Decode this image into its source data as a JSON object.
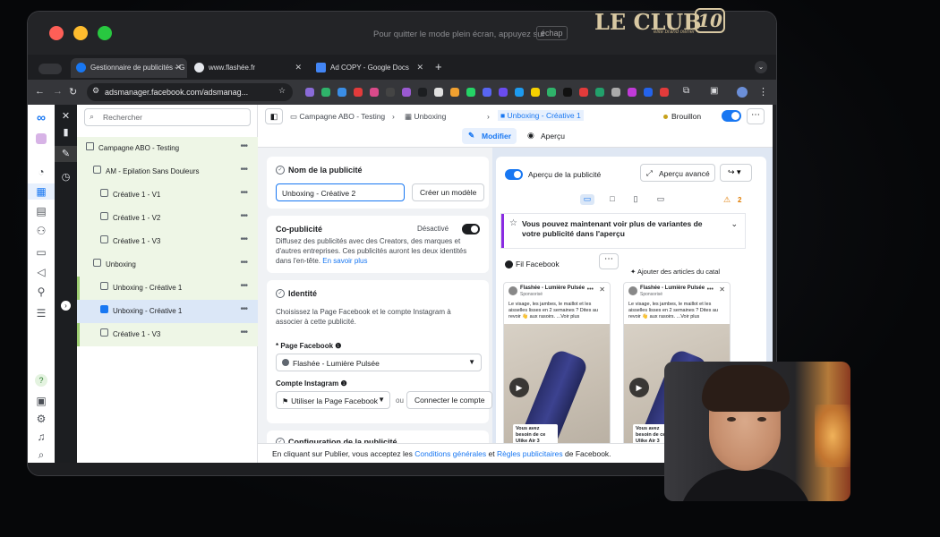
{
  "screen": {
    "fullscreen_message": "Pour quitter le mode plein écran, appuyez sur",
    "fullscreen_key": "échap",
    "brand_logo_text": "LE CLUB",
    "brand_logo_number": "10",
    "brand_logo_subtitle": "elite brand owner"
  },
  "browser": {
    "tabs": [
      {
        "label": "Gestionnaire de publicités - G",
        "icon": "meta-icon",
        "active": true
      },
      {
        "label": "www.flashée.fr",
        "icon": "globe-icon",
        "active": false
      },
      {
        "label": "Ad COPY - Google Docs",
        "icon": "docs-icon",
        "active": false
      }
    ],
    "url": "adsmanager.facebook.com/adsmanag..."
  },
  "tree": {
    "search_placeholder": "Rechercher",
    "rows": [
      {
        "label": "Campagne ABO - Testing",
        "level": 0,
        "icon": "folder-icon"
      },
      {
        "label": "AM - Epilation Sans Douleurs",
        "level": 1,
        "icon": "grid-icon"
      },
      {
        "label": "Créative 1 - V1",
        "level": 2,
        "icon": "ad-icon"
      },
      {
        "label": "Créative 1 - V2",
        "level": 2,
        "icon": "ad-icon"
      },
      {
        "label": "Créative 1 - V3",
        "level": 2,
        "icon": "ad-icon"
      },
      {
        "label": "Unboxing",
        "level": 1,
        "icon": "grid-icon"
      },
      {
        "label": "Unboxing - Créative 1",
        "level": 2,
        "icon": "ad-icon"
      },
      {
        "label": "Unboxing - Créative 1",
        "level": 2,
        "icon": "ad-icon-blue",
        "selected": true
      },
      {
        "label": "Créative 1 - V3",
        "level": 2,
        "icon": "ad-icon"
      }
    ]
  },
  "header": {
    "breadcrumb": [
      "Campagne ABO - Testing",
      "Unboxing",
      "Unboxing - Créative 1"
    ],
    "status": "Brouillon",
    "tab_edit": "Modifier",
    "tab_preview": "Aperçu"
  },
  "form": {
    "ad_name_title": "Nom de la publicité",
    "ad_name_value": "Unboxing - Créative 2",
    "create_template": "Créer un modèle",
    "copub_title": "Co-publicité",
    "copub_state": "Désactivé",
    "copub_desc": "Diffusez des publicités avec des Creators, des marques et d'autres entreprises. Ces publicités auront les deux identités dans l'en-tête.",
    "copub_link": "En savoir plus",
    "identity_title": "Identité",
    "identity_desc": "Choisissez la Page Facebook et le compte Instagram à associer à cette publicité.",
    "page_label": "* Page Facebook",
    "page_value": "Flashée - Lumière Pulsée",
    "ig_label": "Compte Instagram",
    "ig_value": "Utiliser la Page Facebook",
    "ig_or": "ou",
    "connect_account": "Connecter le compte",
    "config_title": "Configuration de la publicité"
  },
  "preview": {
    "toggle_label": "Aperçu de la publicité",
    "advanced": "Aperçu avancé",
    "warning_count": "2",
    "notice": "Vous pouvez maintenant voir plus de variantes de votre publicité dans l'aperçu",
    "feed_label": "Fil Facebook",
    "add_catalog": "Ajouter des articles du catal",
    "posts": [
      {
        "name": "Flashée - Lumière Pulsée",
        "sponsored": "Sponsorisé",
        "body": "Le visage, les jambes, le maillot et les aisselles lisses en 2 semaines ? Dites au revoir 👋 aux rasoirs. ...Voir plus",
        "overlay": "Vous avez besoin de ce Ulike Air 3"
      },
      {
        "name": "Flashée - Lumière Pulsée",
        "sponsored": "Sponsorisé",
        "body": "Le visage, les jambes, le maillot et les aisselles lisses en 2 semaines ? Dites au revoir 👋 aux rasoirs. ...Voir plus",
        "overlay": "Vous avez besoin de ce Ulike Air 3"
      }
    ]
  },
  "footer": {
    "prefix": "En cliquant sur Publier, vous acceptez les",
    "link1": "Conditions générales",
    "and": "et",
    "link2": "Règles publicitaires",
    "suffix": "de Facebook."
  }
}
